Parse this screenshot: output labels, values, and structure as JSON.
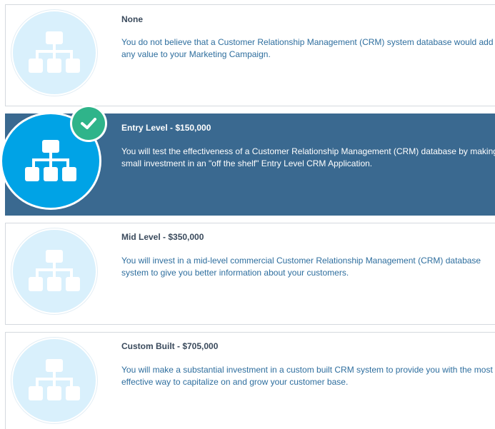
{
  "options": [
    {
      "title": "None",
      "description": "You do not believe that a Customer Relationship Management (CRM) system database would add any value to your Marketing Campaign.",
      "icon": "org-chart-icon",
      "selected": false
    },
    {
      "title": "Entry Level - $150,000",
      "description": "You will test the effectiveness of a Customer Relationship Management (CRM) database by making a small investment in an \"off the shelf\" Entry Level CRM Application.",
      "icon": "org-chart-icon",
      "selected": true
    },
    {
      "title": "Mid Level - $350,000",
      "description": "You will invest in a mid-level commercial Customer Relationship Management (CRM) database system to give you better information about your customers.",
      "icon": "org-chart-icon",
      "selected": false
    },
    {
      "title": "Custom Built - $705,000",
      "description": "You will make a substantial investment in a custom built CRM system to provide you with the most effective way to capitalize on and grow your customer base.",
      "icon": "org-chart-icon",
      "selected": false
    }
  ],
  "selected_indicator_icon": "checkmark-icon",
  "colors": {
    "selected_background": "#3a6990",
    "icon_circle": "#d9f0fc",
    "icon_circle_selected": "#00a3e6",
    "check_badge": "#2fb48a",
    "description_text": "#2e6e9e"
  }
}
